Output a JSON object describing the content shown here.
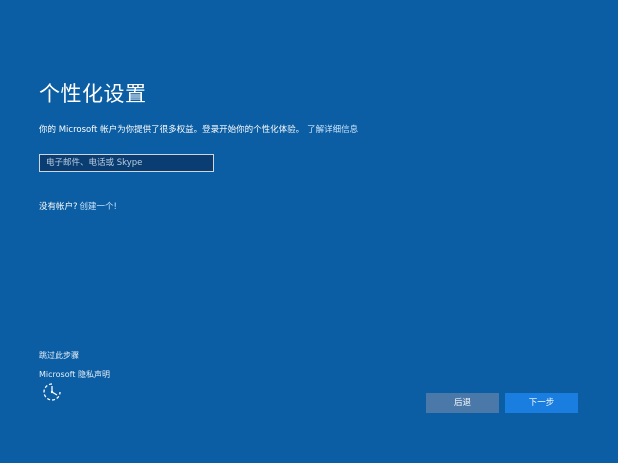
{
  "page": {
    "title": "个性化设置",
    "description": "你的 Microsoft 帐户为你提供了很多权益。登录开始你的个性化体验。",
    "learn_more_link": "了解详细信息"
  },
  "login": {
    "email_placeholder": "电子邮件、电话或 Skype",
    "email_value": ""
  },
  "account": {
    "no_account_text": "没有帐户?",
    "create_link": "创建一个!"
  },
  "footer": {
    "skip_link": "跳过此步骤",
    "privacy_link": "Microsoft 隐私声明",
    "ease_of_access_icon": "ease-of-access-icon"
  },
  "buttons": {
    "back_label": "后退",
    "next_label": "下一步"
  },
  "colors": {
    "background": "#0b5ea3",
    "input_background": "#0a3e72",
    "back_button": "#4a78a9",
    "next_button": "#1a7ee0",
    "link": "#cde6ff"
  }
}
